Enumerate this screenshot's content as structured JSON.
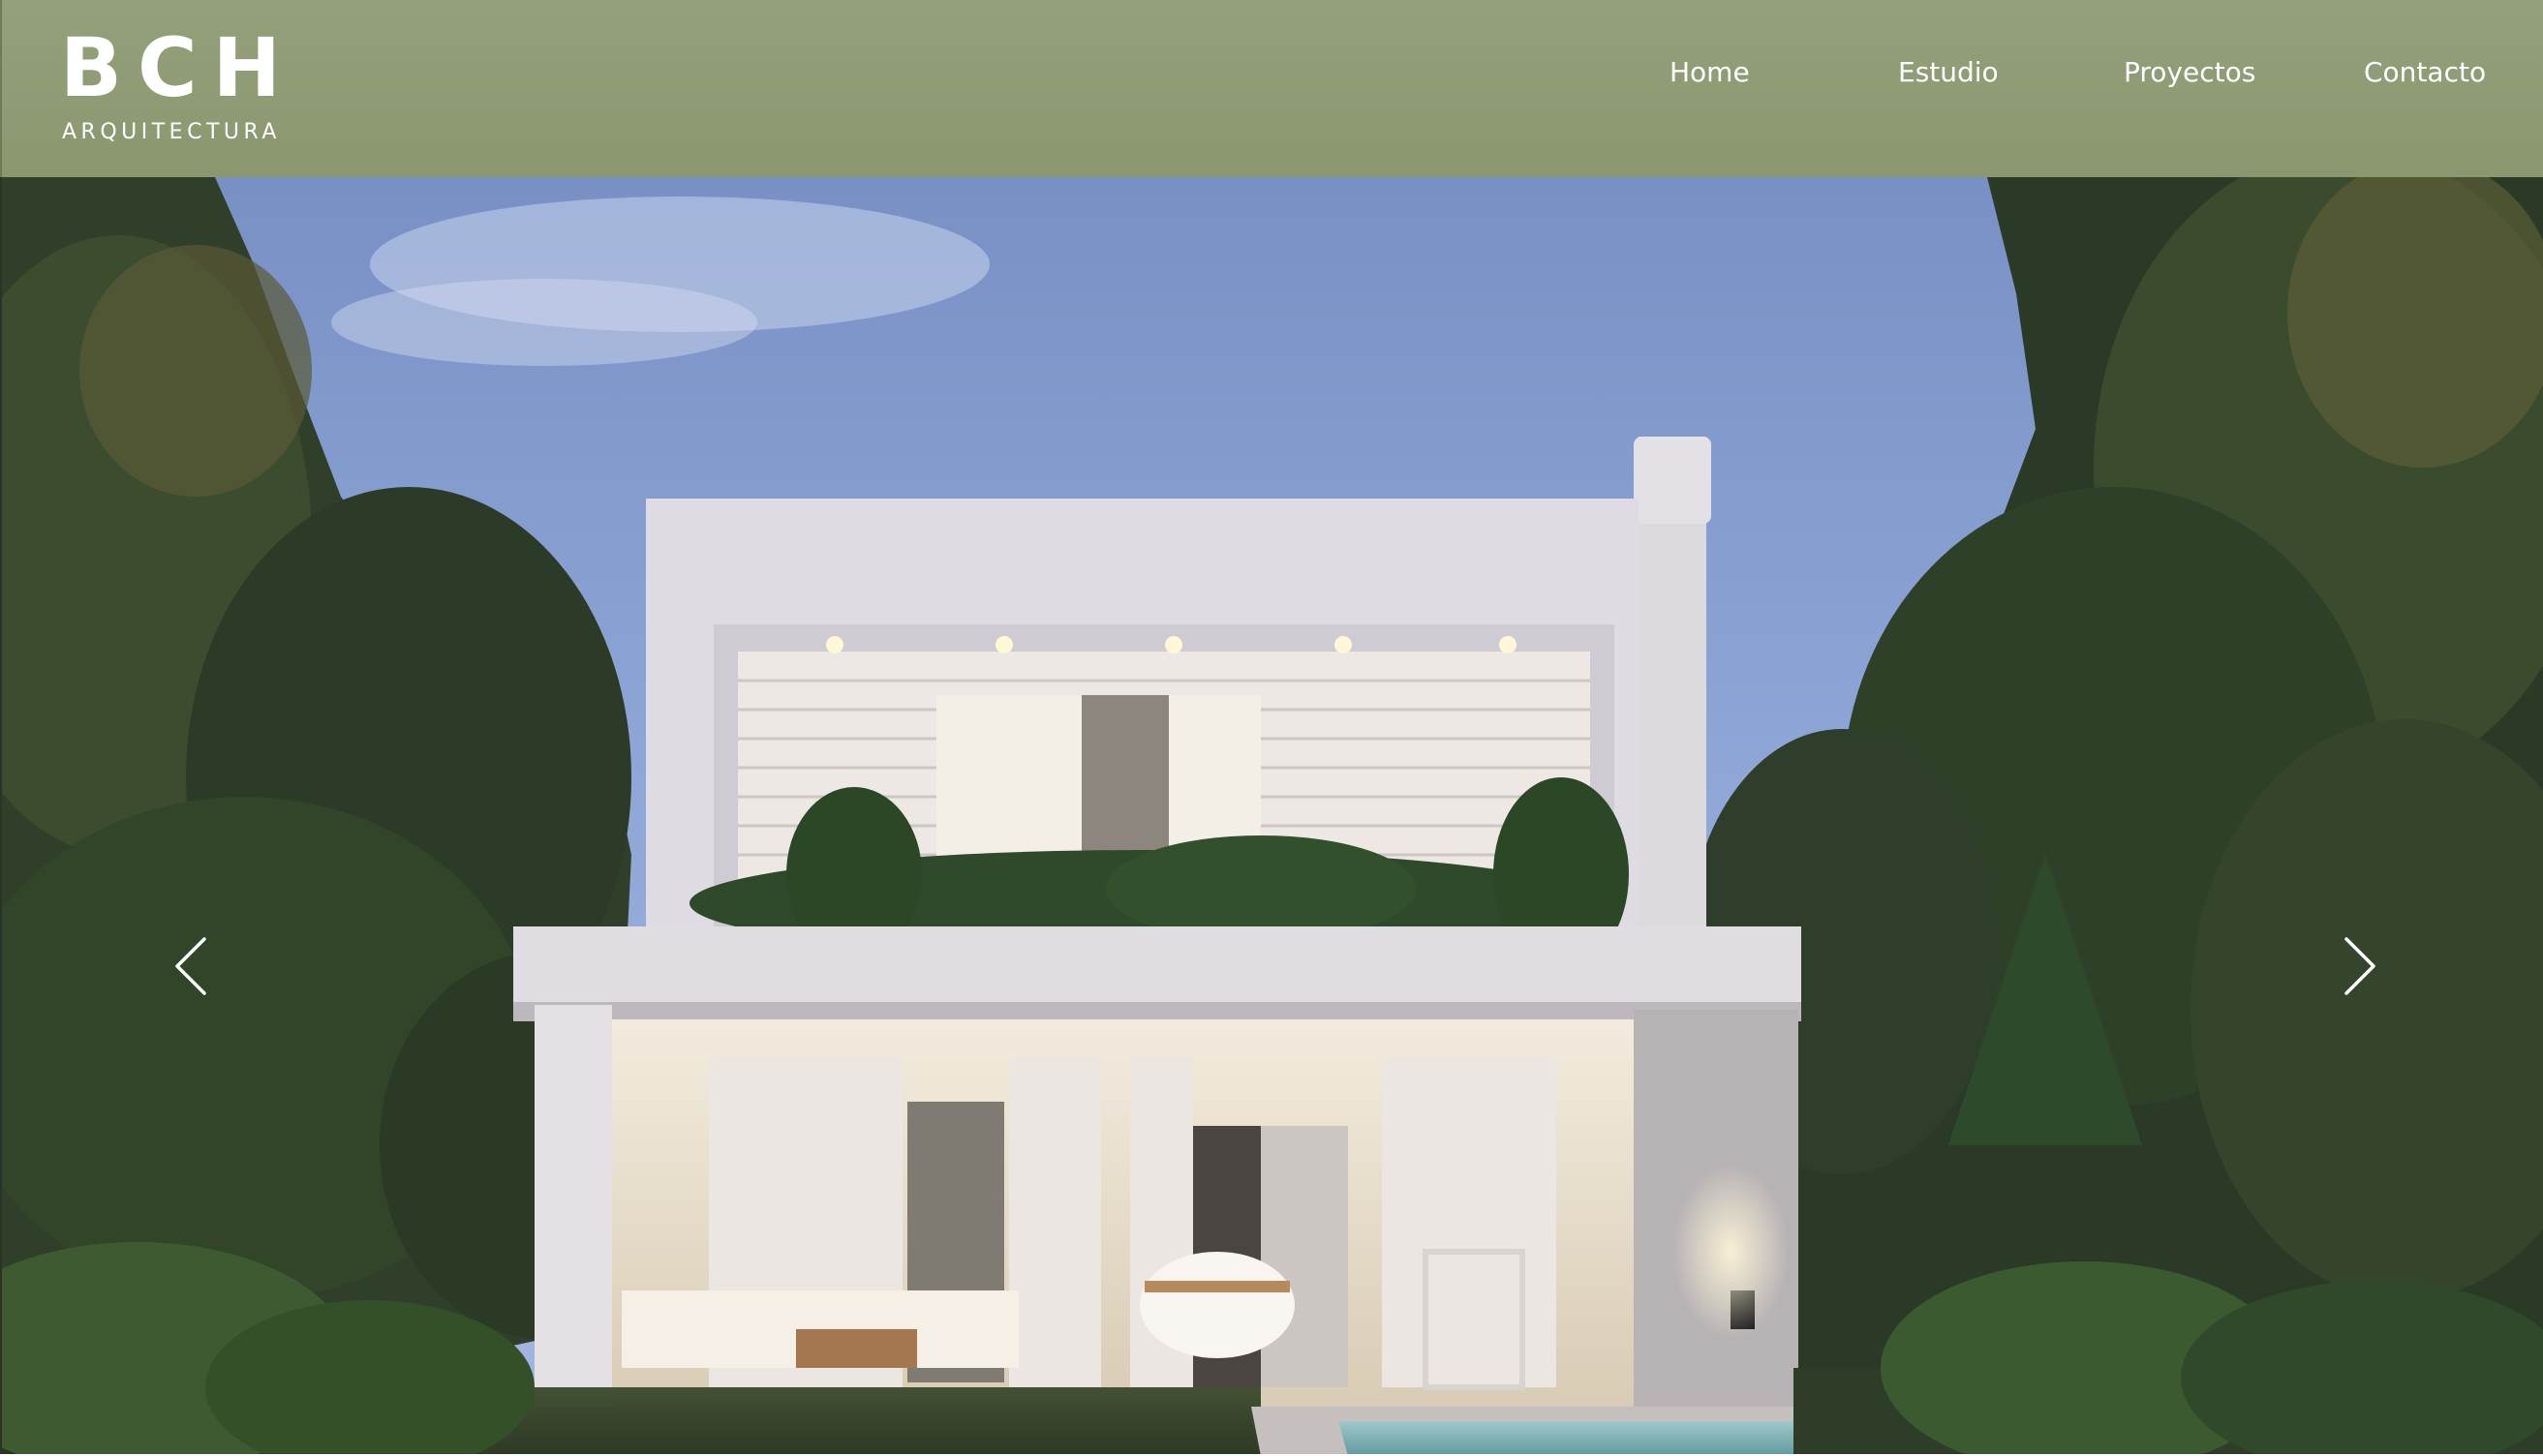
{
  "brand": {
    "logo_mark": "BCH",
    "logo_sub": "ARQUITECTURA",
    "header_color": "#8f9b74"
  },
  "nav": {
    "items": [
      {
        "label": "Home"
      },
      {
        "label": "Estudio"
      },
      {
        "label": "Proyectos"
      },
      {
        "label": "Contacto"
      }
    ]
  },
  "hero": {
    "image": "modern-two-story-house-dusk-render",
    "prev_icon": "chevron-left-icon",
    "next_icon": "chevron-right-icon"
  }
}
